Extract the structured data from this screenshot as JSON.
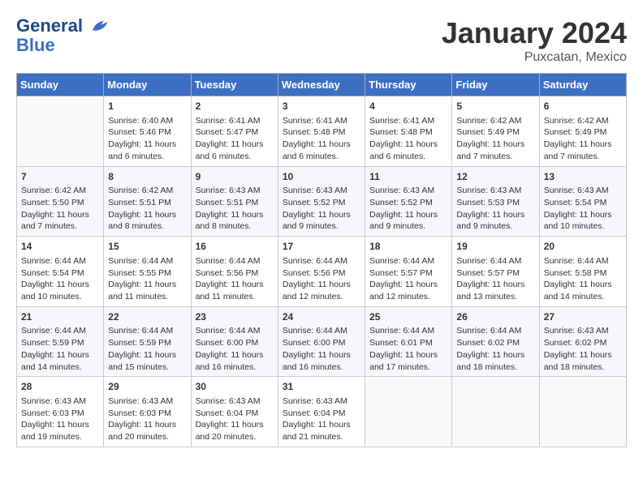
{
  "header": {
    "logo_line1": "General",
    "logo_line2": "Blue",
    "month": "January 2024",
    "location": "Puxcatan, Mexico"
  },
  "days_of_week": [
    "Sunday",
    "Monday",
    "Tuesday",
    "Wednesday",
    "Thursday",
    "Friday",
    "Saturday"
  ],
  "weeks": [
    [
      {
        "day": "",
        "empty": true
      },
      {
        "day": "1",
        "sunrise": "6:40 AM",
        "sunset": "5:46 PM",
        "daylight": "11 hours and 6 minutes."
      },
      {
        "day": "2",
        "sunrise": "6:41 AM",
        "sunset": "5:47 PM",
        "daylight": "11 hours and 6 minutes."
      },
      {
        "day": "3",
        "sunrise": "6:41 AM",
        "sunset": "5:48 PM",
        "daylight": "11 hours and 6 minutes."
      },
      {
        "day": "4",
        "sunrise": "6:41 AM",
        "sunset": "5:48 PM",
        "daylight": "11 hours and 6 minutes."
      },
      {
        "day": "5",
        "sunrise": "6:42 AM",
        "sunset": "5:49 PM",
        "daylight": "11 hours and 7 minutes."
      },
      {
        "day": "6",
        "sunrise": "6:42 AM",
        "sunset": "5:49 PM",
        "daylight": "11 hours and 7 minutes."
      }
    ],
    [
      {
        "day": "7",
        "sunrise": "6:42 AM",
        "sunset": "5:50 PM",
        "daylight": "11 hours and 7 minutes."
      },
      {
        "day": "8",
        "sunrise": "6:42 AM",
        "sunset": "5:51 PM",
        "daylight": "11 hours and 8 minutes."
      },
      {
        "day": "9",
        "sunrise": "6:43 AM",
        "sunset": "5:51 PM",
        "daylight": "11 hours and 8 minutes."
      },
      {
        "day": "10",
        "sunrise": "6:43 AM",
        "sunset": "5:52 PM",
        "daylight": "11 hours and 9 minutes."
      },
      {
        "day": "11",
        "sunrise": "6:43 AM",
        "sunset": "5:52 PM",
        "daylight": "11 hours and 9 minutes."
      },
      {
        "day": "12",
        "sunrise": "6:43 AM",
        "sunset": "5:53 PM",
        "daylight": "11 hours and 9 minutes."
      },
      {
        "day": "13",
        "sunrise": "6:43 AM",
        "sunset": "5:54 PM",
        "daylight": "11 hours and 10 minutes."
      }
    ],
    [
      {
        "day": "14",
        "sunrise": "6:44 AM",
        "sunset": "5:54 PM",
        "daylight": "11 hours and 10 minutes."
      },
      {
        "day": "15",
        "sunrise": "6:44 AM",
        "sunset": "5:55 PM",
        "daylight": "11 hours and 11 minutes."
      },
      {
        "day": "16",
        "sunrise": "6:44 AM",
        "sunset": "5:56 PM",
        "daylight": "11 hours and 11 minutes."
      },
      {
        "day": "17",
        "sunrise": "6:44 AM",
        "sunset": "5:56 PM",
        "daylight": "11 hours and 12 minutes."
      },
      {
        "day": "18",
        "sunrise": "6:44 AM",
        "sunset": "5:57 PM",
        "daylight": "11 hours and 12 minutes."
      },
      {
        "day": "19",
        "sunrise": "6:44 AM",
        "sunset": "5:57 PM",
        "daylight": "11 hours and 13 minutes."
      },
      {
        "day": "20",
        "sunrise": "6:44 AM",
        "sunset": "5:58 PM",
        "daylight": "11 hours and 14 minutes."
      }
    ],
    [
      {
        "day": "21",
        "sunrise": "6:44 AM",
        "sunset": "5:59 PM",
        "daylight": "11 hours and 14 minutes."
      },
      {
        "day": "22",
        "sunrise": "6:44 AM",
        "sunset": "5:59 PM",
        "daylight": "11 hours and 15 minutes."
      },
      {
        "day": "23",
        "sunrise": "6:44 AM",
        "sunset": "6:00 PM",
        "daylight": "11 hours and 16 minutes."
      },
      {
        "day": "24",
        "sunrise": "6:44 AM",
        "sunset": "6:00 PM",
        "daylight": "11 hours and 16 minutes."
      },
      {
        "day": "25",
        "sunrise": "6:44 AM",
        "sunset": "6:01 PM",
        "daylight": "11 hours and 17 minutes."
      },
      {
        "day": "26",
        "sunrise": "6:44 AM",
        "sunset": "6:02 PM",
        "daylight": "11 hours and 18 minutes."
      },
      {
        "day": "27",
        "sunrise": "6:43 AM",
        "sunset": "6:02 PM",
        "daylight": "11 hours and 18 minutes."
      }
    ],
    [
      {
        "day": "28",
        "sunrise": "6:43 AM",
        "sunset": "6:03 PM",
        "daylight": "11 hours and 19 minutes."
      },
      {
        "day": "29",
        "sunrise": "6:43 AM",
        "sunset": "6:03 PM",
        "daylight": "11 hours and 20 minutes."
      },
      {
        "day": "30",
        "sunrise": "6:43 AM",
        "sunset": "6:04 PM",
        "daylight": "11 hours and 20 minutes."
      },
      {
        "day": "31",
        "sunrise": "6:43 AM",
        "sunset": "6:04 PM",
        "daylight": "11 hours and 21 minutes."
      },
      {
        "day": "",
        "empty": true
      },
      {
        "day": "",
        "empty": true
      },
      {
        "day": "",
        "empty": true
      }
    ]
  ],
  "labels": {
    "sunrise_prefix": "Sunrise: ",
    "sunset_prefix": "Sunset: ",
    "daylight_prefix": "Daylight: "
  }
}
